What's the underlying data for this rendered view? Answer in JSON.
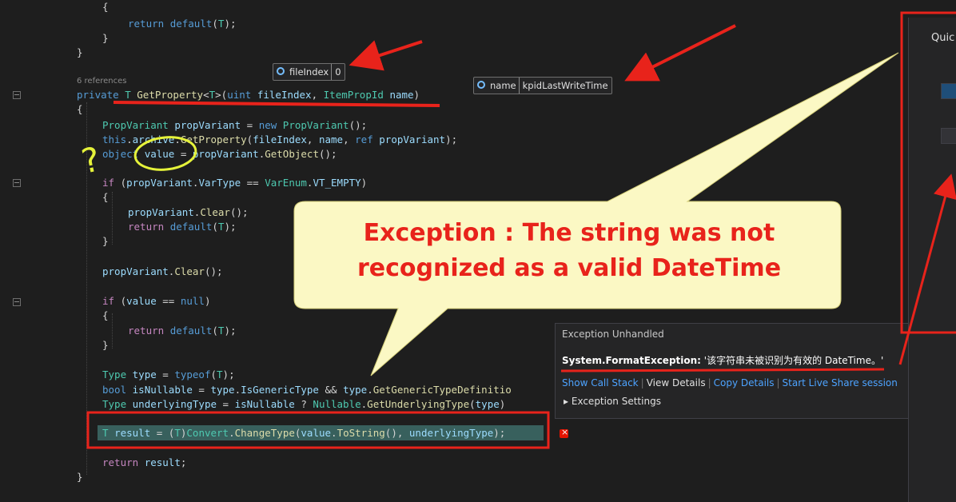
{
  "editor": {
    "refs_label": "6 references",
    "lines": [
      {
        "id": "l1",
        "tokens": [
          {
            "c": "p",
            "t": "{"
          }
        ]
      },
      {
        "id": "l2",
        "tokens": [
          {
            "c": "kw",
            "t": "return "
          },
          {
            "c": "kw",
            "t": "default"
          },
          {
            "c": "p",
            "t": "("
          },
          {
            "c": "ty",
            "t": "T"
          },
          {
            "c": "p",
            "t": ");"
          }
        ]
      },
      {
        "id": "l3",
        "tokens": [
          {
            "c": "p",
            "t": "}"
          }
        ]
      },
      {
        "id": "l4",
        "tokens": [
          {
            "c": "p",
            "t": "}"
          }
        ]
      },
      {
        "id": "l5",
        "tokens": [
          {
            "c": "kw",
            "t": "private "
          },
          {
            "c": "ty",
            "t": "T "
          },
          {
            "c": "fn",
            "t": "GetProperty"
          },
          {
            "c": "p",
            "t": "<"
          },
          {
            "c": "ty",
            "t": "T"
          },
          {
            "c": "p",
            "t": ">("
          },
          {
            "c": "kw",
            "t": "uint "
          },
          {
            "c": "va",
            "t": "fileIndex"
          },
          {
            "c": "p",
            "t": ", "
          },
          {
            "c": "ty",
            "t": "ItemPropId "
          },
          {
            "c": "va",
            "t": "name"
          },
          {
            "c": "p",
            "t": ")"
          }
        ]
      },
      {
        "id": "l6",
        "tokens": [
          {
            "c": "p",
            "t": "{"
          }
        ]
      },
      {
        "id": "l7",
        "tokens": [
          {
            "c": "ty",
            "t": "PropVariant "
          },
          {
            "c": "va",
            "t": "propVariant"
          },
          {
            "c": "p",
            "t": " = "
          },
          {
            "c": "kw",
            "t": "new "
          },
          {
            "c": "ty",
            "t": "PropVariant"
          },
          {
            "c": "p",
            "t": "();"
          }
        ]
      },
      {
        "id": "l8",
        "tokens": [
          {
            "c": "kw",
            "t": "this"
          },
          {
            "c": "p",
            "t": "."
          },
          {
            "c": "va",
            "t": "archive"
          },
          {
            "c": "p",
            "t": "."
          },
          {
            "c": "fn",
            "t": "GetProperty"
          },
          {
            "c": "p",
            "t": "("
          },
          {
            "c": "va",
            "t": "fileIndex"
          },
          {
            "c": "p",
            "t": ", "
          },
          {
            "c": "va",
            "t": "name"
          },
          {
            "c": "p",
            "t": ", "
          },
          {
            "c": "kw",
            "t": "ref "
          },
          {
            "c": "va",
            "t": "propVariant"
          },
          {
            "c": "p",
            "t": ");"
          }
        ]
      },
      {
        "id": "l9",
        "tokens": [
          {
            "c": "kw",
            "t": "object "
          },
          {
            "c": "va",
            "t": "value"
          },
          {
            "c": "p",
            "t": " = "
          },
          {
            "c": "va",
            "t": "propVariant"
          },
          {
            "c": "p",
            "t": "."
          },
          {
            "c": "fn",
            "t": "GetObject"
          },
          {
            "c": "p",
            "t": "();"
          }
        ]
      },
      {
        "id": "l10",
        "tokens": [
          {
            "c": "ct",
            "t": "if "
          },
          {
            "c": "p",
            "t": "("
          },
          {
            "c": "va",
            "t": "propVariant"
          },
          {
            "c": "p",
            "t": "."
          },
          {
            "c": "va",
            "t": "VarType"
          },
          {
            "c": "p",
            "t": " == "
          },
          {
            "c": "ty",
            "t": "VarEnum"
          },
          {
            "c": "p",
            "t": "."
          },
          {
            "c": "va",
            "t": "VT_EMPTY"
          },
          {
            "c": "p",
            "t": ")"
          }
        ]
      },
      {
        "id": "l11",
        "tokens": [
          {
            "c": "p",
            "t": "{"
          }
        ]
      },
      {
        "id": "l12",
        "tokens": [
          {
            "c": "va",
            "t": "propVariant"
          },
          {
            "c": "p",
            "t": "."
          },
          {
            "c": "fn",
            "t": "Clear"
          },
          {
            "c": "p",
            "t": "();"
          }
        ]
      },
      {
        "id": "l13",
        "tokens": [
          {
            "c": "ct",
            "t": "return "
          },
          {
            "c": "kw",
            "t": "default"
          },
          {
            "c": "p",
            "t": "("
          },
          {
            "c": "ty",
            "t": "T"
          },
          {
            "c": "p",
            "t": ");"
          }
        ]
      },
      {
        "id": "l14",
        "tokens": [
          {
            "c": "p",
            "t": "}"
          }
        ]
      },
      {
        "id": "l15",
        "tokens": [
          {
            "c": "va",
            "t": "propVariant"
          },
          {
            "c": "p",
            "t": "."
          },
          {
            "c": "fn",
            "t": "Clear"
          },
          {
            "c": "p",
            "t": "();"
          }
        ]
      },
      {
        "id": "l16",
        "tokens": [
          {
            "c": "ct",
            "t": "if "
          },
          {
            "c": "p",
            "t": "("
          },
          {
            "c": "va",
            "t": "value"
          },
          {
            "c": "p",
            "t": " == "
          },
          {
            "c": "kw",
            "t": "null"
          },
          {
            "c": "p",
            "t": ")"
          }
        ]
      },
      {
        "id": "l17",
        "tokens": [
          {
            "c": "p",
            "t": "{"
          }
        ]
      },
      {
        "id": "l18",
        "tokens": [
          {
            "c": "ct",
            "t": "return "
          },
          {
            "c": "kw",
            "t": "default"
          },
          {
            "c": "p",
            "t": "("
          },
          {
            "c": "ty",
            "t": "T"
          },
          {
            "c": "p",
            "t": ");"
          }
        ]
      },
      {
        "id": "l19",
        "tokens": [
          {
            "c": "p",
            "t": "}"
          }
        ]
      },
      {
        "id": "l20",
        "tokens": [
          {
            "c": "ty",
            "t": "Type "
          },
          {
            "c": "va",
            "t": "type"
          },
          {
            "c": "p",
            "t": " = "
          },
          {
            "c": "kw",
            "t": "typeof"
          },
          {
            "c": "p",
            "t": "("
          },
          {
            "c": "ty",
            "t": "T"
          },
          {
            "c": "p",
            "t": ");"
          }
        ]
      },
      {
        "id": "l21",
        "tokens": [
          {
            "c": "kw",
            "t": "bool "
          },
          {
            "c": "va",
            "t": "isNullable"
          },
          {
            "c": "p",
            "t": " = "
          },
          {
            "c": "va",
            "t": "type"
          },
          {
            "c": "p",
            "t": "."
          },
          {
            "c": "va",
            "t": "IsGenericType"
          },
          {
            "c": "p",
            "t": " && "
          },
          {
            "c": "va",
            "t": "type"
          },
          {
            "c": "p",
            "t": "."
          },
          {
            "c": "fn",
            "t": "GetGenericTypeDefinitio"
          }
        ]
      },
      {
        "id": "l22",
        "tokens": [
          {
            "c": "ty",
            "t": "Type "
          },
          {
            "c": "va",
            "t": "underlyingType"
          },
          {
            "c": "p",
            "t": " = "
          },
          {
            "c": "va",
            "t": "isNullable"
          },
          {
            "c": "p",
            "t": " ? "
          },
          {
            "c": "ty",
            "t": "Nullable"
          },
          {
            "c": "p",
            "t": "."
          },
          {
            "c": "fn",
            "t": "GetUnderlyingType"
          },
          {
            "c": "p",
            "t": "("
          },
          {
            "c": "va",
            "t": "type"
          },
          {
            "c": "p",
            "t": ")"
          }
        ]
      },
      {
        "id": "l23",
        "tokens": [
          {
            "c": "ty",
            "t": "T "
          },
          {
            "c": "va",
            "t": "result"
          },
          {
            "c": "p",
            "t": " = ("
          },
          {
            "c": "ty",
            "t": "T"
          },
          {
            "c": "p",
            "t": ")"
          },
          {
            "c": "ty",
            "t": "Convert"
          },
          {
            "c": "p",
            "t": "."
          },
          {
            "c": "fn",
            "t": "ChangeType"
          },
          {
            "c": "p",
            "t": "("
          },
          {
            "c": "va",
            "t": "value"
          },
          {
            "c": "p",
            "t": "."
          },
          {
            "c": "fn",
            "t": "ToString"
          },
          {
            "c": "p",
            "t": "(), "
          },
          {
            "c": "va",
            "t": "underlyingType"
          },
          {
            "c": "p",
            "t": ");"
          }
        ]
      },
      {
        "id": "l24",
        "tokens": [
          {
            "c": "ct",
            "t": "return "
          },
          {
            "c": "va",
            "t": "result"
          },
          {
            "c": "p",
            "t": ";"
          }
        ]
      },
      {
        "id": "l25",
        "tokens": [
          {
            "c": "p",
            "t": "}"
          }
        ]
      }
    ]
  },
  "datatips": {
    "fileindex": {
      "name": "fileIndex",
      "value": "0"
    },
    "name": {
      "name": "name",
      "value": "kpidLastWriteTime"
    }
  },
  "callout": {
    "line1": "Exception : The string was not",
    "line2": "recognized as a valid DateTime"
  },
  "exception": {
    "header": "Exception Unhandled",
    "type": "System.FormatException:",
    "message": " '该字符串未被识别为有效的 DateTime。'",
    "links": {
      "call_stack": "Show Call Stack",
      "view_details": "View Details",
      "copy_details": "Copy Details",
      "live_share": "Start Live Share session"
    },
    "settings": "Exception Settings"
  },
  "quickwatch": {
    "title": "Quic"
  },
  "annotations": {
    "question_mark": "?",
    "color": "#e8231b"
  },
  "colors": {
    "keyword": "#569cd6",
    "type": "#4ec9b0",
    "method": "#dcdcaa",
    "variable": "#9cdcfe",
    "control": "#c586c0",
    "callout_bg": "#fbf8c4"
  }
}
